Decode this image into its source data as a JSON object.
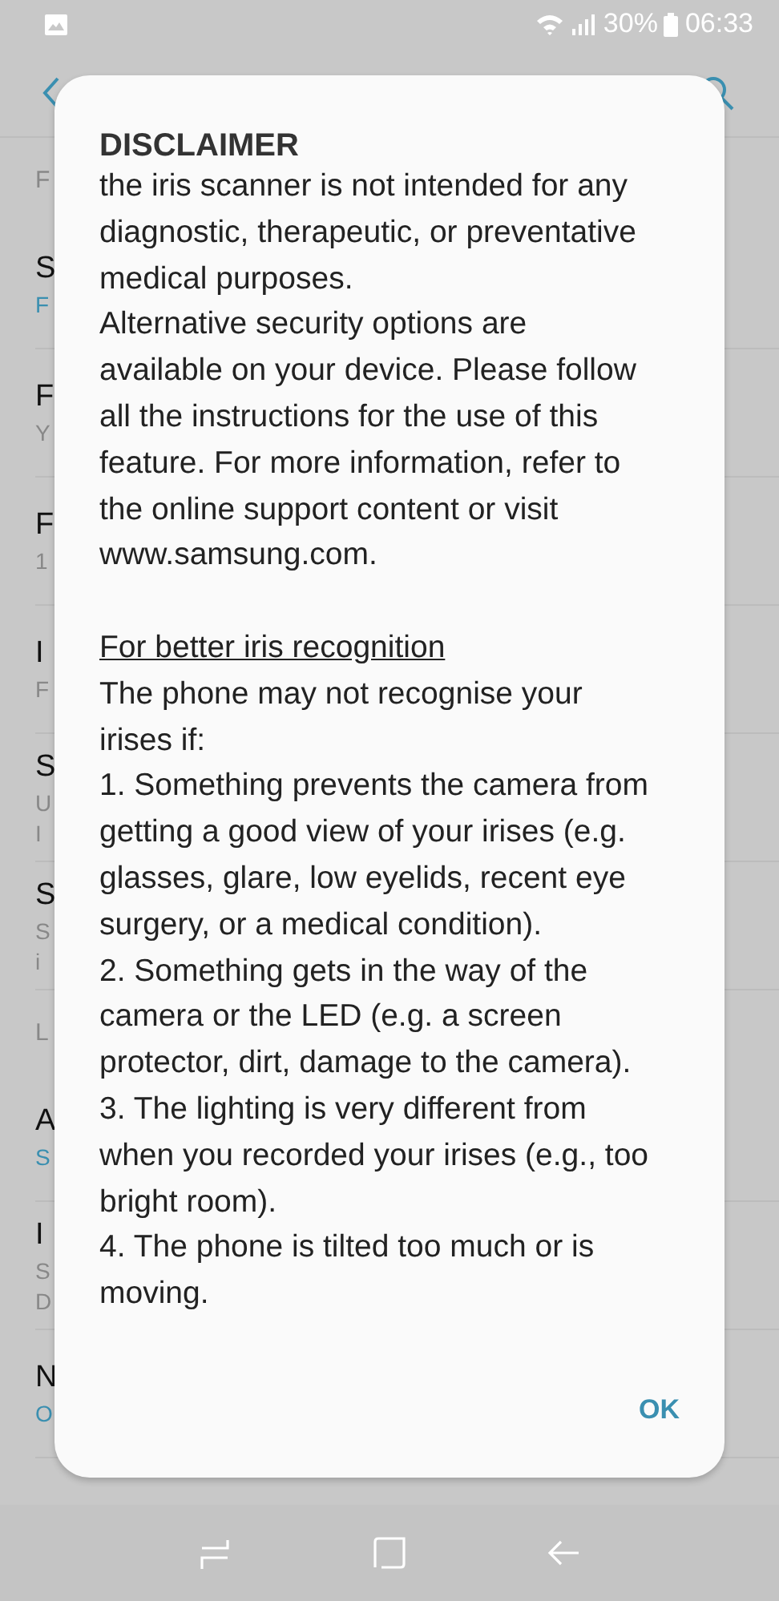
{
  "status_bar": {
    "battery": "30%",
    "time": "06:33"
  },
  "background_rows": [
    {
      "kind": "header",
      "title": "F"
    },
    {
      "kind": "item",
      "title": "S",
      "subtitle": "F",
      "accent": true
    },
    {
      "kind": "item",
      "title": "F",
      "subtitle": "Y",
      "accent": false
    },
    {
      "kind": "item",
      "title": "F",
      "subtitle": "1",
      "accent": false
    },
    {
      "kind": "item",
      "title": "I",
      "subtitle": "F",
      "accent": false
    },
    {
      "kind": "item",
      "title": "S",
      "subtitle": "U",
      "extra": "I",
      "accent": false
    },
    {
      "kind": "item",
      "title": "S",
      "subtitle": "S",
      "extra": "i",
      "accent": false
    },
    {
      "kind": "header",
      "title": "L"
    },
    {
      "kind": "item",
      "title": "A",
      "subtitle": "S",
      "accent": true
    },
    {
      "kind": "item",
      "title": "I",
      "subtitle": "S",
      "extra": "D",
      "accent": false
    },
    {
      "kind": "item",
      "title": "N",
      "subtitle": "O",
      "accent": true
    }
  ],
  "dialog": {
    "title": "DISCLAIMER",
    "body": [
      {
        "kind": "text",
        "text": "the iris scanner is not intended for any diagnostic, therapeutic, or preventative medical purposes."
      },
      {
        "kind": "text",
        "text": "Alternative security options are available on your device. Please follow all the instructions for the use of this feature. For more information, refer to the online support content or visit www.samsung.com."
      },
      {
        "kind": "heading",
        "text": "For better iris recognition"
      },
      {
        "kind": "text",
        "text": "The phone may not recognise your irises if:"
      },
      {
        "kind": "text",
        "text": "1. Something prevents the camera from getting a good view of your irises (e.g. glasses, glare, low eyelids, recent eye surgery, or a medical condition)."
      },
      {
        "kind": "text",
        "text": "2. Something gets in the way of the camera or the LED (e.g. a screen protector, dirt, damage to the camera)."
      },
      {
        "kind": "text",
        "text": "3. The lighting is very different from when you recorded your irises (e.g., too bright room)."
      },
      {
        "kind": "text",
        "text": "4. The phone is tilted too much or is moving."
      }
    ],
    "button": "OK"
  }
}
